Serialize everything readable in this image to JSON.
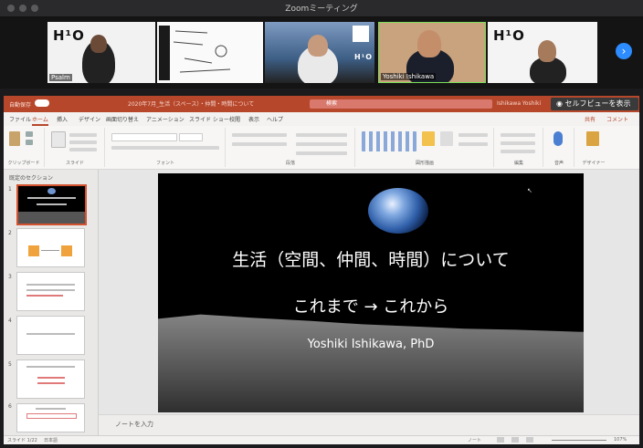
{
  "window": {
    "title": "Zoomミーティング"
  },
  "gallery": {
    "participants": [
      {
        "label": "H¹O",
        "name": "Psalm"
      },
      {
        "label": "",
        "name": ""
      },
      {
        "label": "H¹O",
        "name": ""
      },
      {
        "label": "",
        "name": "Yoshiki Ishikawa"
      },
      {
        "label": "H¹O",
        "name": ""
      }
    ],
    "next_icon": "chevron-right-icon"
  },
  "powerpoint": {
    "autosave": "自動保存",
    "title": "2020年7月_生活（スペース）・仲間・時間について",
    "search_placeholder": "検索",
    "user": "Ishikawa Yoshiki",
    "selfview_label": "セルフビューを表示",
    "tabs": [
      "ファイル",
      "ホーム",
      "挿入",
      "デザイン",
      "画面切り替え",
      "アニメーション",
      "スライド ショー",
      "校閲",
      "表示",
      "ヘルプ"
    ],
    "share": "共有",
    "comment": "コメント",
    "ribbon_groups": [
      "クリップボード",
      "スライド",
      "フォント",
      "段落",
      "図形描画",
      "編集",
      "音声",
      "デザイナー"
    ],
    "section": "既定のセクション",
    "slide_numbers": [
      "1",
      "2",
      "3",
      "4",
      "5",
      "6"
    ],
    "notes_placeholder": "ノートを入力",
    "status_slide": "スライド 1/22",
    "status_lang": "日本語",
    "status_notes": "ノート",
    "zoom": "107%"
  },
  "slide": {
    "title": "生活（空間、仲間、時間）について",
    "subtitle": "これまで → これから",
    "author": "Yoshiki Ishikawa, PhD"
  },
  "colors": {
    "ppt_accent": "#b7472a",
    "zoom_blue": "#2d8cff"
  }
}
